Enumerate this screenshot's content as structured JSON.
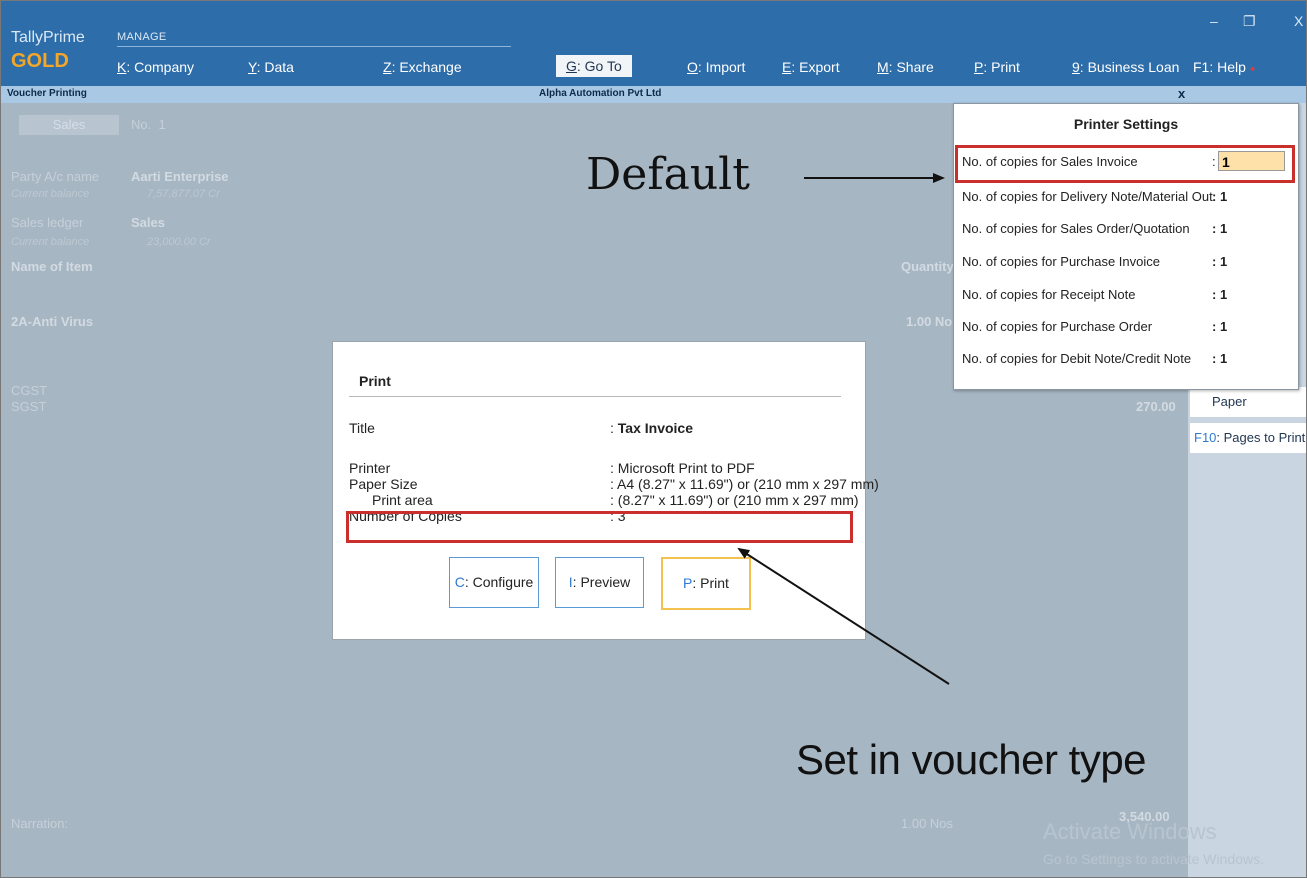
{
  "app": {
    "name": "TallyPrime",
    "edition": "GOLD",
    "section_label": "MANAGE"
  },
  "menu": [
    {
      "key": "K",
      "label": "Company"
    },
    {
      "key": "Y",
      "label": "Data"
    },
    {
      "key": "Z",
      "label": "Exchange"
    },
    {
      "key": "G",
      "label": "Go To"
    },
    {
      "key": "O",
      "label": "Import"
    },
    {
      "key": "E",
      "label": "Export"
    },
    {
      "key": "M",
      "label": "Share"
    },
    {
      "key": "P",
      "label": "Print"
    },
    {
      "key": "9",
      "label": "Business Loan"
    },
    {
      "key": "F1",
      "label": "Help"
    }
  ],
  "window_controls": {
    "minimize": "–",
    "restore": "❐",
    "close": "X"
  },
  "subheader": {
    "screen": "Voucher Printing",
    "company": "Alpha Automation Pvt Ltd",
    "close": "x"
  },
  "voucher": {
    "type": "Sales",
    "no_label": "No.",
    "no": "1",
    "party_label": "Party A/c name",
    "party_value": "Aarti Enterprise",
    "party_balance_label": "Current balance",
    "party_balance": "7,57,877.07 Cr",
    "sales_ledger_label": "Sales ledger",
    "sales_ledger_value": "Sales",
    "sales_balance_label": "Current balance",
    "sales_balance": "23,000.00 Cr",
    "item_col": "Name of Item",
    "qty_col": "Quantity",
    "item": "2A-Anti Virus",
    "item_qty": "1.00 No",
    "tax1": "CGST",
    "tax2": "SGST",
    "tax_amount": "270.00",
    "narration_label": "Narration:",
    "total_qty": "1.00 Nos",
    "total_amount": "3,540.00"
  },
  "right_panel": [
    {
      "key": "",
      "label": "Paper"
    },
    {
      "key": "F10",
      "label": "Pages to Print"
    }
  ],
  "print_dialog": {
    "heading": "Print",
    "title_label": "Title",
    "title_value": "Tax Invoice",
    "printer_label": "Printer",
    "printer_value": "Microsoft Print to PDF",
    "paper_size_label": "Paper Size",
    "paper_size_value": "A4 (8.27\" x 11.69\") or (210 mm x 297 mm)",
    "print_area_label": "Print area",
    "print_area_value": "(8.27\" x 11.69\") or (210 mm x 297 mm)",
    "copies_label": "Number of Copies",
    "copies_value": "3",
    "separator": ":",
    "buttons": [
      {
        "key": "C",
        "label": "Configure"
      },
      {
        "key": "I",
        "label": "Preview"
      },
      {
        "key": "P",
        "label": "Print"
      }
    ]
  },
  "printer_settings": {
    "title": "Printer Settings",
    "rows": [
      {
        "label": "No. of copies for Sales Invoice",
        "value": "1"
      },
      {
        "label": "No. of copies for Delivery Note/Material Out",
        "value": "1"
      },
      {
        "label": "No. of copies for Sales Order/Quotation",
        "value": "1"
      },
      {
        "label": "No. of copies for Purchase Invoice",
        "value": "1"
      },
      {
        "label": "No. of copies for Receipt Note",
        "value": "1"
      },
      {
        "label": "No. of copies for Purchase Order",
        "value": "1"
      },
      {
        "label": "No. of copies for Debit Note/Credit Note",
        "value": "1"
      }
    ]
  },
  "annotations": {
    "default": "Default",
    "set_in_voucher": "Set in voucher type"
  },
  "watermark": {
    "line1": "Activate Windows",
    "line2": "Go to Settings to activate Windows."
  },
  "colors": {
    "topbar": "#2d6da9",
    "subbar": "#a9c8e4",
    "workspace": "#a7b6c3",
    "accent_gold": "#f2a62a",
    "highlight_red": "#c9302c",
    "input_fill": "#fde1a8"
  }
}
